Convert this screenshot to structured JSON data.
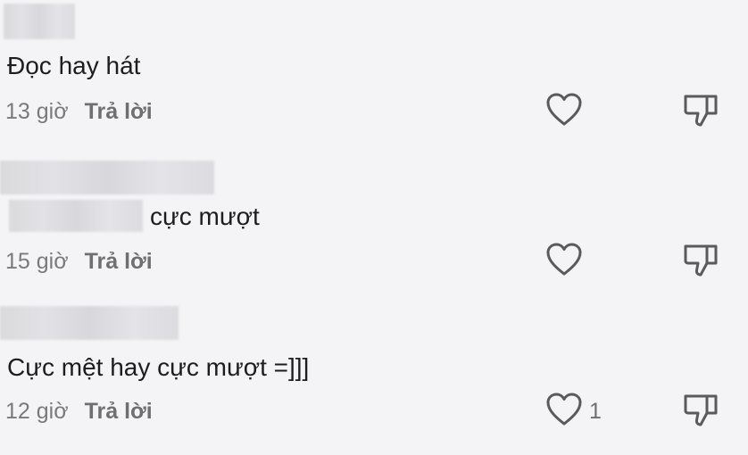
{
  "comments": [
    {
      "text": "Đọc hay hát",
      "time": "13 giờ",
      "reply_label": "Trả lời",
      "likes": ""
    },
    {
      "text_suffix": "cực mượt",
      "time": "15 giờ",
      "reply_label": "Trả lời",
      "likes": ""
    },
    {
      "text": "Cực mệt hay cực mượt =]]]",
      "time": "12 giờ",
      "reply_label": "Trả lời",
      "likes": "1"
    }
  ],
  "icons": {
    "like": "heart-outline-icon",
    "dislike": "thumbs-down-outline-icon"
  },
  "colors": {
    "background": "#f4f4f6",
    "text": "#1d1d1f",
    "meta": "#7a7a7e"
  }
}
